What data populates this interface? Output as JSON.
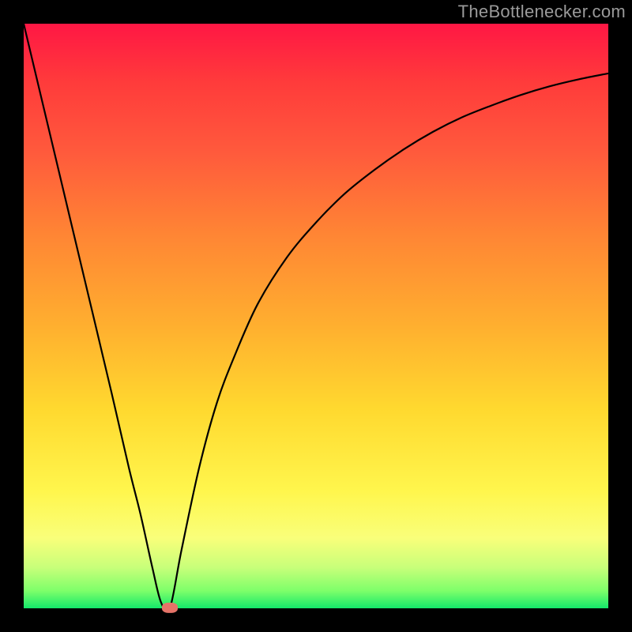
{
  "watermark": "TheBottlenecker.com",
  "chart_data": {
    "type": "line",
    "title": "",
    "xlabel": "",
    "ylabel": "",
    "xlim": [
      0,
      100
    ],
    "ylim": [
      0,
      100
    ],
    "x": [
      0,
      5,
      10,
      15,
      18,
      20,
      22,
      23.5,
      25,
      27,
      30,
      33,
      36,
      40,
      45,
      50,
      55,
      60,
      65,
      70,
      75,
      80,
      85,
      90,
      95,
      100
    ],
    "values": [
      100,
      79,
      58,
      37,
      24,
      16,
      7,
      1,
      0,
      10,
      24,
      35,
      43,
      52,
      60,
      66,
      71,
      75,
      78.5,
      81.5,
      84,
      86,
      87.8,
      89.3,
      90.5,
      91.5
    ],
    "marker": {
      "x": 25,
      "y": 0
    }
  },
  "colors": {
    "curve": "#000000",
    "marker": "#e57368",
    "frame": "#000000"
  }
}
